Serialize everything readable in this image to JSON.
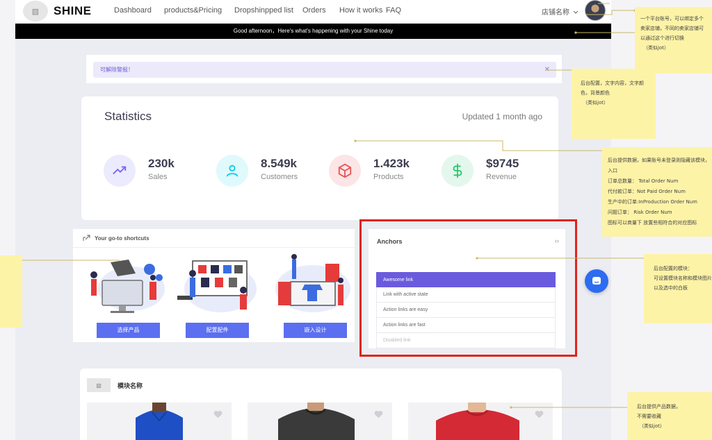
{
  "nav": {
    "logo_placeholder": "▧",
    "brand": "SHINE",
    "links": [
      "Dashboard",
      "products&Pricing",
      "Dropshinpped list",
      "Orders",
      "How it works",
      "FAQ"
    ],
    "store_name": "店铺名称"
  },
  "banner": {
    "text": "Good afternoon，Here's what's happening with your Shine today"
  },
  "alert": {
    "text": "可解除警报！",
    "close": "✕"
  },
  "stats": {
    "title": "Statistics",
    "updated": "Updated 1 month ago",
    "items": [
      {
        "value": "230k",
        "label": "Sales",
        "icon": "trending-up-icon",
        "color": "#7367f0",
        "bg": "#ecebfd"
      },
      {
        "value": "8.549k",
        "label": "Customers",
        "icon": "user-icon",
        "color": "#00cfe8",
        "bg": "#e0f9fc"
      },
      {
        "value": "1.423k",
        "label": "Products",
        "icon": "box-icon",
        "color": "#ea5455",
        "bg": "#fce5e6"
      },
      {
        "value": "$9745",
        "label": "Revenue",
        "icon": "dollar-icon",
        "color": "#28c76f",
        "bg": "#e4f7ec"
      }
    ]
  },
  "shortcuts": {
    "title": "Your go-to shortcuts",
    "buttons": [
      "选择产品",
      "配置配件",
      "嵌入设计"
    ]
  },
  "anchors": {
    "title": "Anchors",
    "code_icon": "‹›",
    "items": [
      "Awesome link",
      "Link with active state",
      "Action links are easy",
      "Action links are fast",
      "Disabled link"
    ]
  },
  "module": {
    "icon_placeholder": "▧",
    "title": "模块名称"
  },
  "notes": {
    "account": [
      "一个平台账号，可以绑定多个",
      "卖家店铺，不同的卖家店铺可",
      "以通过这个进行切换",
      "（类似jot）"
    ],
    "banner": [
      "后台配置，文字内容，文字颜",
      "色，背景颜色",
      "（类似jot）"
    ],
    "stats": [
      "后台提供数据，如果账号未登录则隐藏该模块，",
      "入口",
      "订单总数量： Total Order Num",
      "代付款订单：Not Paid Order Num",
      "生产中的订单:InProduction Order Num",
      "问题订单： Risk Order Num",
      "图标可以商量下 放置些相符合的对应图标"
    ],
    "anchors": [
      "后台配置的模块：",
      "可设置模块名称和模块图片",
      "以及选中的白板"
    ],
    "products": [
      "后台提供产品数据，",
      "不需要收藏",
      "（类似jot）"
    ]
  },
  "colors": {
    "accent": "#5b6ff0",
    "anchor_active": "#6a5bde",
    "highlight": "#e0241b",
    "note": "#fdf3a7"
  }
}
